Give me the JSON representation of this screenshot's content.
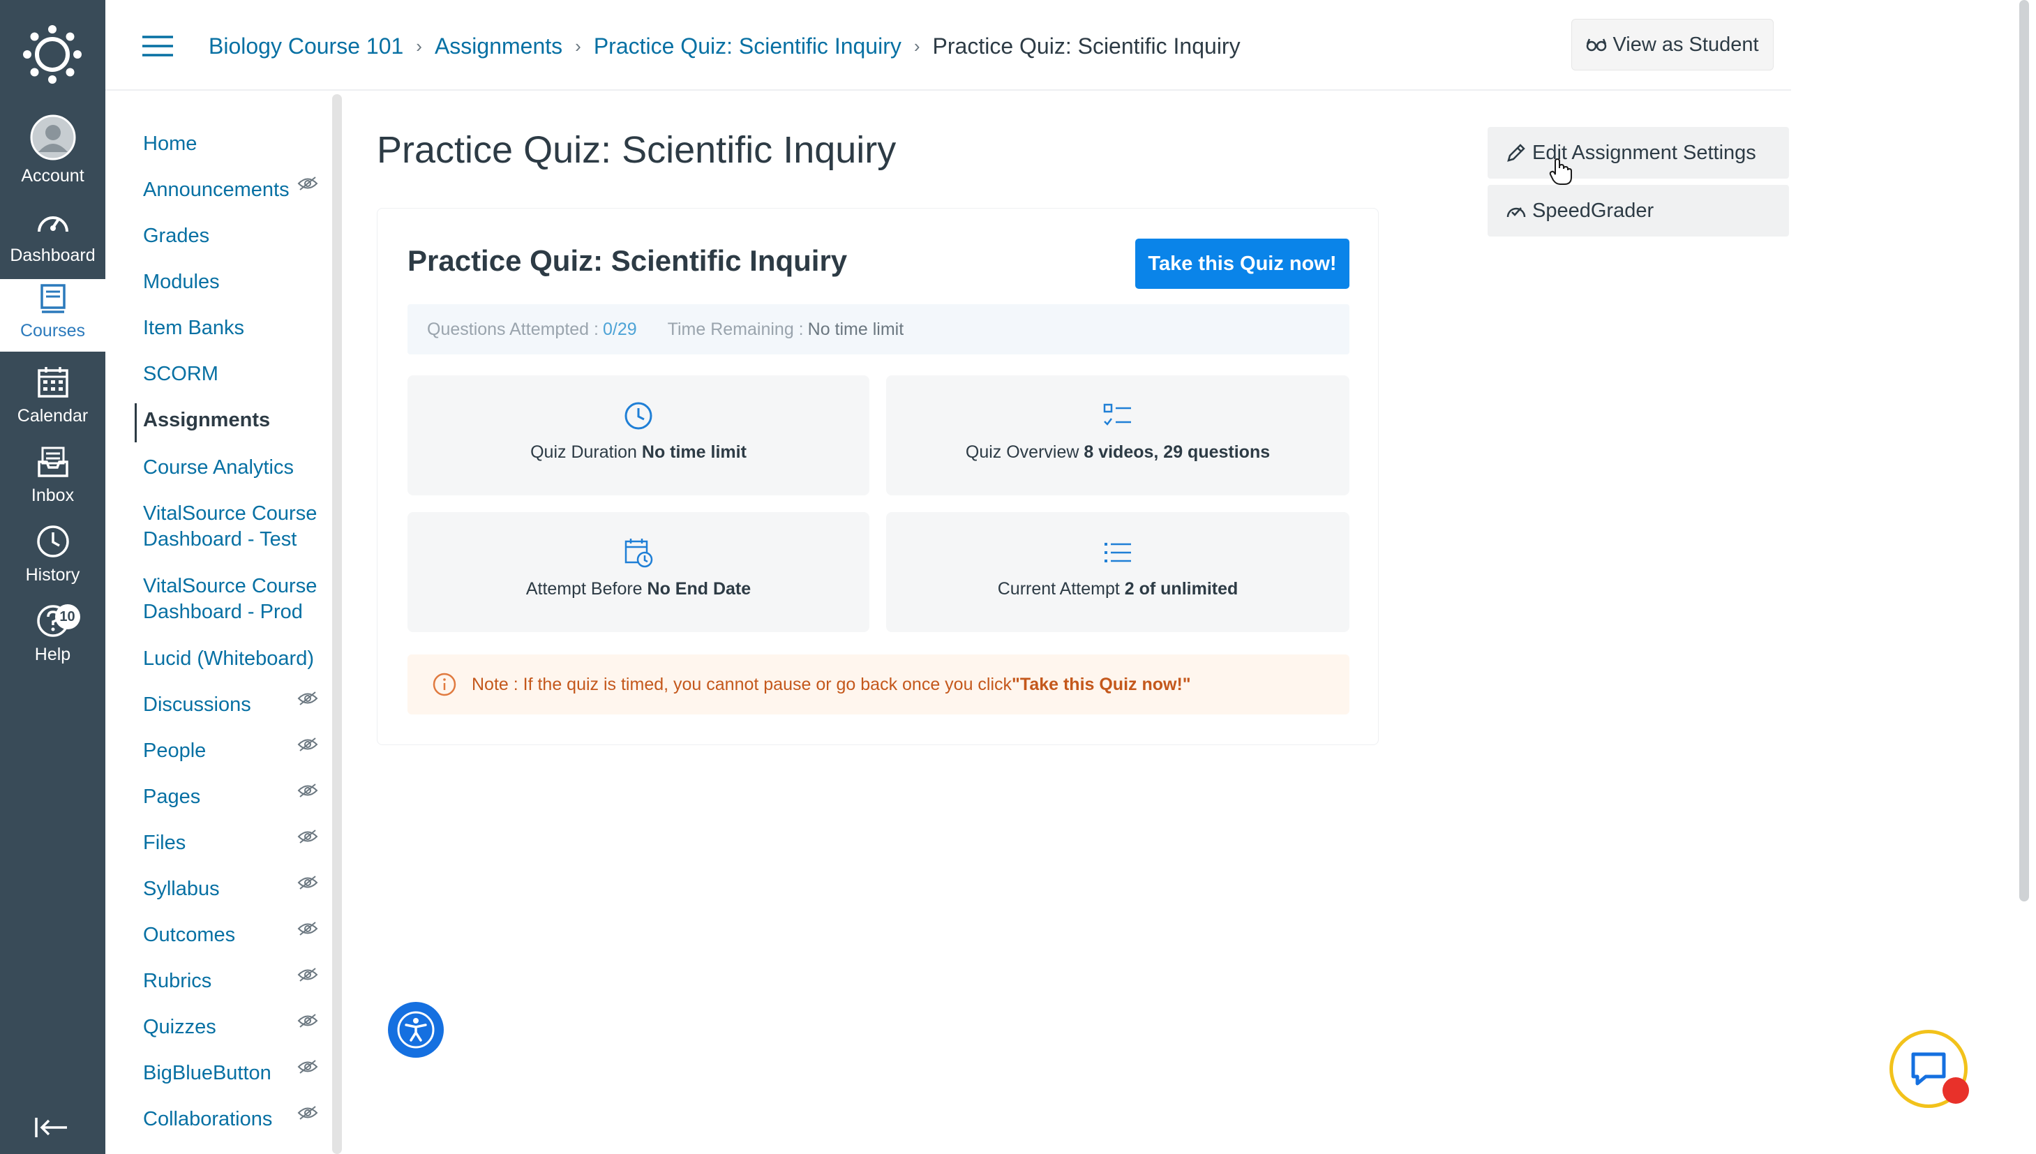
{
  "global_nav": {
    "items": [
      {
        "label": "Account",
        "icon": "avatar-icon"
      },
      {
        "label": "Dashboard",
        "icon": "dashboard-icon"
      },
      {
        "label": "Courses",
        "icon": "courses-icon"
      },
      {
        "label": "Calendar",
        "icon": "calendar-icon"
      },
      {
        "label": "Inbox",
        "icon": "inbox-icon"
      },
      {
        "label": "History",
        "icon": "history-icon"
      },
      {
        "label": "Help",
        "icon": "help-icon",
        "badge": "10"
      }
    ],
    "active": "Courses"
  },
  "breadcrumb": [
    "Biology Course 101",
    "Assignments",
    "Practice Quiz: Scientific Inquiry",
    "Practice Quiz: Scientific Inquiry"
  ],
  "header": {
    "view_as_student": "View as Student"
  },
  "course_nav": {
    "items": [
      {
        "label": "Home",
        "hidden": false
      },
      {
        "label": "Announcements",
        "hidden": true
      },
      {
        "label": "Grades",
        "hidden": false
      },
      {
        "label": "Modules",
        "hidden": false
      },
      {
        "label": "Item Banks",
        "hidden": false
      },
      {
        "label": "SCORM",
        "hidden": false
      },
      {
        "label": "Assignments",
        "hidden": false,
        "active": true
      },
      {
        "label": "Course Analytics",
        "hidden": false
      },
      {
        "label": "VitalSource Course Dashboard - Test",
        "hidden": false
      },
      {
        "label": "VitalSource Course Dashboard - Prod",
        "hidden": false
      },
      {
        "label": "Lucid (Whiteboard)",
        "hidden": false
      },
      {
        "label": "Discussions",
        "hidden": true
      },
      {
        "label": "People",
        "hidden": true
      },
      {
        "label": "Pages",
        "hidden": true
      },
      {
        "label": "Files",
        "hidden": true
      },
      {
        "label": "Syllabus",
        "hidden": true
      },
      {
        "label": "Outcomes",
        "hidden": true
      },
      {
        "label": "Rubrics",
        "hidden": true
      },
      {
        "label": "Quizzes",
        "hidden": true
      },
      {
        "label": "BigBlueButton",
        "hidden": true
      },
      {
        "label": "Collaborations",
        "hidden": true
      }
    ]
  },
  "page": {
    "title": "Practice Quiz: Scientific Inquiry",
    "quiz": {
      "heading": "Practice Quiz: Scientific Inquiry",
      "take_button": "Take this Quiz now!",
      "questions_attempted_label": "Questions Attempted : ",
      "questions_attempted_value": "0/29",
      "time_remaining_label": "Time Remaining : ",
      "time_remaining_value": "No time limit",
      "tiles": [
        {
          "label": "Quiz Duration ",
          "value": "No time limit",
          "icon": "clock-icon"
        },
        {
          "label": "Quiz Overview ",
          "value": "8 videos, 29 questions",
          "icon": "checklist-icon"
        },
        {
          "label": "Attempt Before ",
          "value": "No End Date",
          "icon": "calendar-clock-icon"
        },
        {
          "label": "Current Attempt ",
          "value": "2 of unlimited",
          "icon": "list-icon"
        }
      ],
      "note_text": "Note : If the quiz is timed, you cannot pause or go back once you click ",
      "note_emphasis": "\"Take this Quiz now!\""
    }
  },
  "sidebar": {
    "edit_settings": "Edit Assignment Settings",
    "speedgrader": "SpeedGrader"
  },
  "colors": {
    "nav_bg": "#394b58",
    "link": "#0770a3",
    "primary_button": "#0a84e9",
    "note_text": "#c4581c"
  }
}
